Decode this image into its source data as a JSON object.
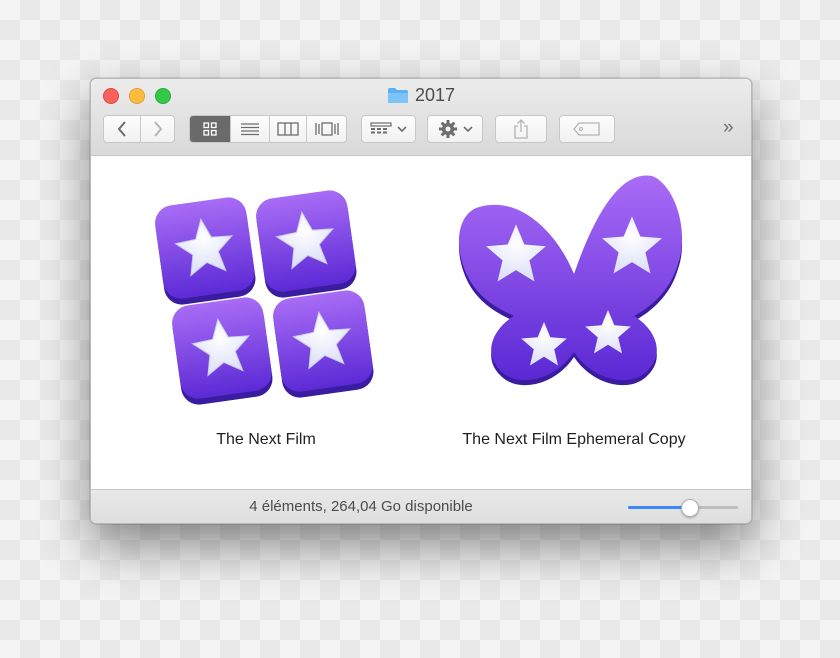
{
  "window": {
    "title": "2017",
    "folder_icon": "folder-icon"
  },
  "toolbar": {
    "back_icon": "chevron-left-icon",
    "forward_icon": "chevron-right-icon",
    "view_modes": [
      "icon-view",
      "list-view",
      "column-view",
      "cover-flow-view"
    ],
    "active_view": "icon-view",
    "arrange_icon": "arrange-grid-icon",
    "action_icon": "gear-icon",
    "share_icon": "share-icon",
    "tag_icon": "tag-icon",
    "overflow_label": "»"
  },
  "files": [
    {
      "name": "The Next Film",
      "icon": "app-icon-four-stars"
    },
    {
      "name": "The Next Film Ephemeral Copy",
      "icon": "app-icon-butterfly"
    }
  ],
  "status": {
    "text": "4 éléments, 264,04 Go disponible",
    "icon_size_level": 0.55
  },
  "colors": {
    "accent": "#3b88f7",
    "icon_purple_light": "#a86cf5",
    "icon_purple_dark": "#5c2ad6"
  }
}
